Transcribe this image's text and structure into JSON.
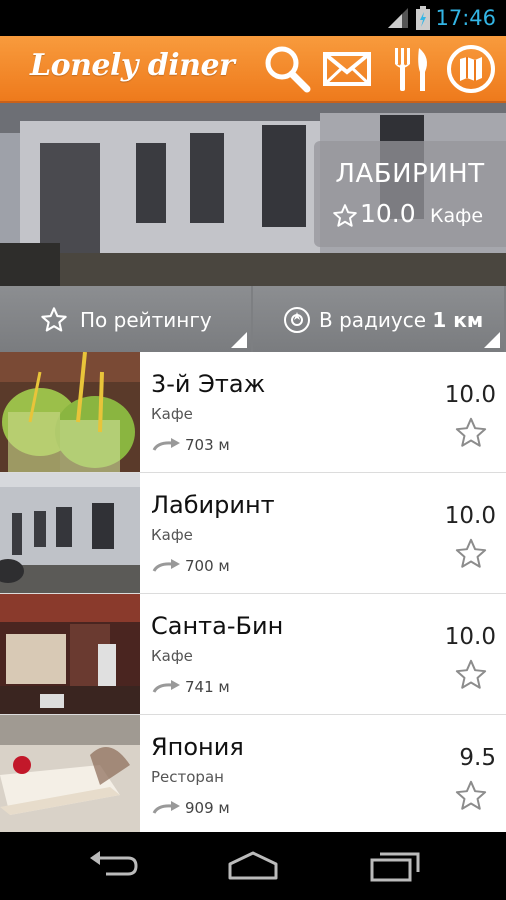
{
  "status_bar": {
    "time": "17:46"
  },
  "app": {
    "logo_text": "Lonely diner"
  },
  "action_icons": [
    "search-icon",
    "mail-icon",
    "fork-knife-icon",
    "map-icon"
  ],
  "featured": {
    "name": "ЛАБИРИНТ",
    "rating": "10.0",
    "type": "Кафе"
  },
  "filters": {
    "rating_label": "По рейтингу",
    "radius_label": "В радиусе",
    "radius_value": "1 км"
  },
  "restaurants": [
    {
      "name": "3-й Этаж",
      "type": "Кафе",
      "distance": "703 м",
      "rating": "10.0"
    },
    {
      "name": "Лабиринт",
      "type": "Кафе",
      "distance": "700 м",
      "rating": "10.0"
    },
    {
      "name": "Санта-Бин",
      "type": "Кафе",
      "distance": "741 м",
      "rating": "10.0"
    },
    {
      "name": "Япония",
      "type": "Ресторан",
      "distance": "909 м",
      "rating": "9.5"
    }
  ],
  "colors": {
    "accent": "#f28a2c",
    "status_time": "#33b5e5"
  }
}
